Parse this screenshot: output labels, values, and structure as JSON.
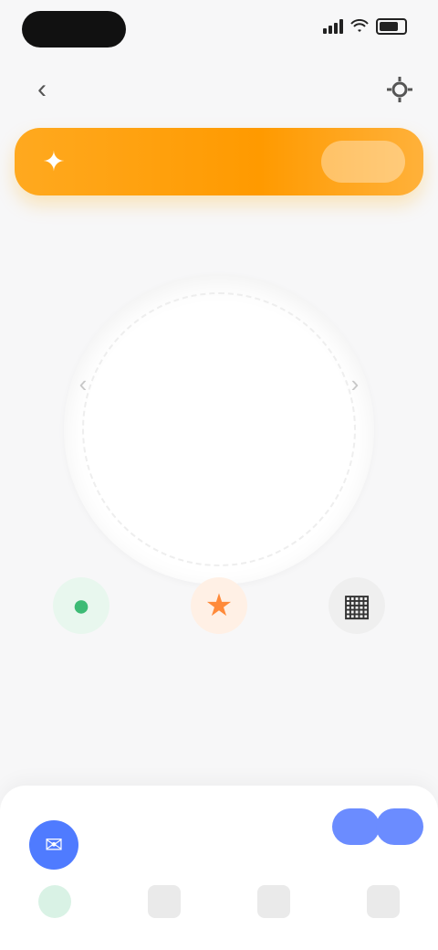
{
  "status": {
    "time": "",
    "icons": [
      "signal-icon",
      "wifi-icon",
      "battery-icon"
    ]
  },
  "nav": {
    "title": "",
    "back_icon": "chevron-left-icon",
    "settings_icon": "gear-icon"
  },
  "banner": {
    "text": "",
    "button_label": "",
    "icon": "flame-icon"
  },
  "score": {
    "value": "",
    "caption": "",
    "footnote": ""
  },
  "actions": [
    {
      "label": "",
      "icon": "leaf-icon",
      "color": "#3dbb75"
    },
    {
      "label": "",
      "icon": "star-icon",
      "color": "#ff8a3a"
    },
    {
      "label": "",
      "icon": "grid-icon",
      "color": "#333333"
    }
  ],
  "assistant": {
    "text": "",
    "avatar_icon": "chat-icon"
  },
  "tabs": [
    {
      "label": "",
      "icon": "home-icon"
    },
    {
      "label": "",
      "icon": "chart-icon"
    },
    {
      "label": "",
      "icon": "map-icon"
    },
    {
      "label": "",
      "icon": "user-icon"
    }
  ],
  "colors": {
    "accent_orange": "#ffa91f",
    "accent_blue": "#4f7bff"
  }
}
